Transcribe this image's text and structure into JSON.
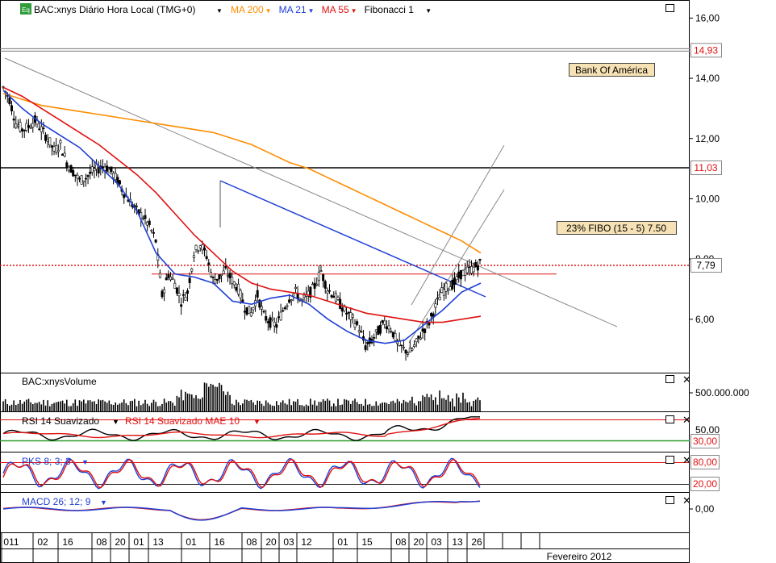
{
  "header": {
    "badge": "Eq",
    "symbol": "BAC:xnys Diário Hora Local (TMG+0)",
    "studies": [
      {
        "label": "MA 200",
        "color": "#ff8c00"
      },
      {
        "label": "MA 21",
        "color": "#1f3fd6"
      },
      {
        "label": "MA 55",
        "color": "#e01010"
      },
      {
        "label": "Fibonacci 1",
        "color": "#000000"
      }
    ]
  },
  "price_panel": {
    "annotation": "Bank Of América",
    "fibo_label": "23% FIBO (15 - 5)  7.50",
    "tick_labels": [
      "16,00",
      "14,00",
      "12,00",
      "10,00",
      "8,00",
      "6,00"
    ],
    "level_badges": [
      {
        "text": "14,93",
        "value": 14.93
      },
      {
        "text": "11,03",
        "value": 11.03
      },
      {
        "text": "7,79",
        "value": 7.79
      }
    ]
  },
  "volume_panel": {
    "title": "BAC:xnysVolume",
    "tick_label": "500.000.000"
  },
  "rsi_panel": {
    "title_a": "RSI 14 Suavizado",
    "title_b": "RSI 14 Suavizado MAE 10",
    "tick_label": "50,00",
    "badge": "30,00"
  },
  "pks_panel": {
    "title": "PKS 8; 3; 3",
    "badges": [
      "80,00",
      "20,00"
    ]
  },
  "macd_panel": {
    "title": "MACD 26; 12; 9",
    "tick_label": "0,00"
  },
  "x_axis": {
    "labels": [
      "011",
      "02",
      "16",
      "08",
      "20",
      "01",
      "13",
      "01",
      "16",
      "08",
      "20",
      "03",
      "12",
      "01",
      "15",
      "08",
      "20",
      "03",
      "13",
      "26"
    ],
    "month_label": "Fevereiro 2012"
  },
  "chart_data": {
    "type": "line",
    "ylim": [
      4.2,
      16.6
    ],
    "price_series": [
      13.7,
      13.3,
      12.5,
      12.3,
      12.4,
      12.6,
      12.3,
      12.0,
      11.6,
      11.8,
      11.2,
      10.9,
      10.6,
      10.7,
      10.9,
      11.0,
      11.1,
      10.9,
      10.6,
      10.2,
      9.9,
      9.6,
      9.4,
      9.1,
      8.6,
      6.8,
      7.5,
      7.2,
      6.6,
      6.9,
      8.2,
      8.5,
      8.1,
      7.3,
      7.4,
      7.6,
      7.3,
      7.0,
      6.4,
      6.2,
      6.8,
      6.1,
      5.9,
      5.8,
      6.3,
      6.7,
      6.9,
      6.6,
      6.8,
      7.1,
      7.6,
      7.0,
      6.8,
      6.5,
      6.2,
      6.0,
      5.7,
      5.1,
      5.3,
      5.6,
      5.9,
      5.7,
      5.2,
      5.0,
      4.9,
      5.2,
      5.6,
      5.9,
      6.4,
      6.9,
      7.1,
      7.2,
      7.5,
      7.6,
      7.7,
      7.85
    ],
    "ma200": [
      13.5,
      13.3,
      13.1,
      13.0,
      12.9,
      12.8,
      12.7,
      12.6,
      12.5,
      12.4,
      12.3,
      12.2,
      12.0,
      11.8,
      11.5,
      11.2,
      11.0,
      10.7,
      10.4,
      10.1,
      9.8,
      9.5,
      9.2,
      8.9,
      8.6,
      8.2
    ],
    "ma55": [
      13.7,
      13.4,
      13.0,
      12.6,
      12.2,
      11.8,
      11.3,
      10.8,
      10.2,
      9.5,
      8.8,
      8.2,
      7.6,
      7.2,
      7.0,
      6.9,
      6.8,
      6.6,
      6.4,
      6.2,
      6.1,
      6.0,
      5.9,
      5.9,
      6.0,
      6.1
    ],
    "ma21": [
      13.6,
      13.0,
      12.5,
      12.1,
      11.7,
      11.1,
      10.5,
      9.6,
      8.2,
      7.5,
      7.4,
      7.2,
      6.6,
      6.5,
      6.7,
      6.8,
      6.5,
      6.0,
      5.6,
      5.3,
      5.2,
      5.3,
      5.8,
      6.3,
      6.9,
      7.2
    ],
    "levels": [
      {
        "name": "",
        "value": 14.93,
        "color": "#555555"
      },
      {
        "name": "",
        "value": 11.03,
        "color": "#000000"
      },
      {
        "name": "",
        "value": 7.79,
        "color": "#e01010"
      },
      {
        "name": "23% FIBO (15 - 5)",
        "value": 7.5,
        "color": "#e01010"
      }
    ],
    "rsi_levels": [
      50,
      30
    ],
    "pks_levels": [
      80,
      20
    ],
    "volume_tick": 500000000
  }
}
